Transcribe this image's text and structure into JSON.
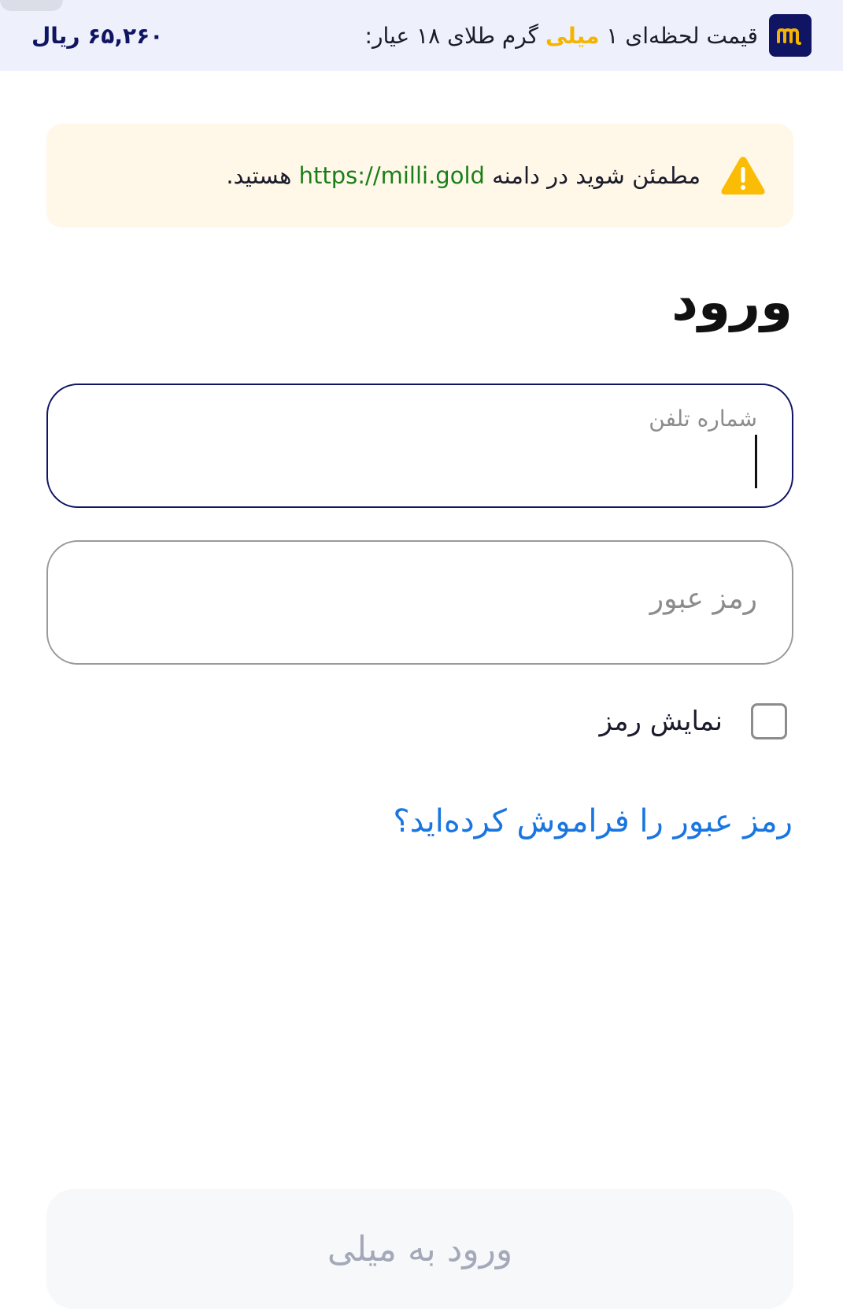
{
  "header": {
    "logo_text": "m",
    "price_label_part1": "قیمت لحظه‌ای ۱ ",
    "price_label_highlight": "میلی",
    "price_label_part2": " گرم طلای ۱۸ عیار:",
    "price_value": "۶۵,۲۶۰ ریال"
  },
  "warning": {
    "icon": "warning-triangle-icon",
    "text_part1": "مطمئن شوید در دامنه ",
    "url": "https://milli.gold",
    "text_part2": " هستید."
  },
  "title": "ورود",
  "phone_field": {
    "label": "شماره تلفن",
    "value": ""
  },
  "password_field": {
    "placeholder": "رمز عبور",
    "value": ""
  },
  "show_password": {
    "label": "نمایش رمز",
    "checked": false
  },
  "forgot_link": "رمز عبور را فراموش کرده‌اید؟",
  "submit_button": "ورود به میلی",
  "colors": {
    "brand_navy": "#0f1463",
    "brand_gold": "#f5b400",
    "link_blue": "#1976e0",
    "url_green": "#1a7f1a",
    "warning_bg": "#fff8e8"
  }
}
